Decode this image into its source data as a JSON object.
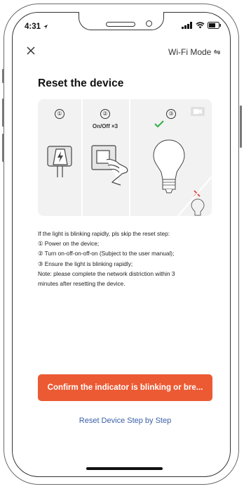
{
  "status_bar": {
    "time": "4:31"
  },
  "nav": {
    "close_icon": "close-icon",
    "mode_label": "Wi-Fi Mode ⇋"
  },
  "page": {
    "title": "Reset the device"
  },
  "illustration": {
    "steps": [
      {
        "number": "①"
      },
      {
        "number": "②",
        "caption": "On/Off ×3"
      },
      {
        "number": "③"
      }
    ],
    "colors": {
      "check": "#2fb14a",
      "cross": "#e0453a",
      "panel": "#f2f2f2"
    }
  },
  "instructions": {
    "lines": [
      "If the light is blinking rapidly, pls skip the reset step:",
      "① Power on the device;",
      "② Turn on-off-on-off-on (Subject to the user manual);",
      "③ Ensure the light is blinking rapidly;",
      "Note: please complete the network distriction within 3",
      "minutes after resetting the device."
    ]
  },
  "actions": {
    "primary_label": "Confirm the indicator is blinking or bre...",
    "secondary_label": "Reset Device Step by Step"
  },
  "theme": {
    "accent": "#ec5a33",
    "link": "#3a5fa8"
  }
}
